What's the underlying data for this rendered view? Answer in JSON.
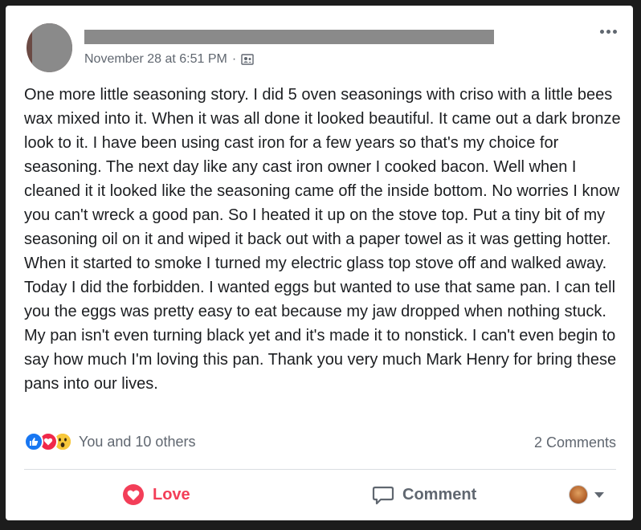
{
  "post": {
    "timestamp": "November 28 at 6:51 PM",
    "separator": "·",
    "audience_icon": "friends-icon",
    "text": "One more little seasoning story. I did 5 oven seasonings with criso with a little bees wax mixed into it. When it was all done it looked beautiful. It came out a dark bronze look to it. I have been using cast iron for a few years so that's my choice for seasoning. The next day like any cast iron owner I cooked bacon. Well when I cleaned it it looked like the seasoning came off the inside bottom. No worries I know you can't wreck a good pan. So I heated it up on the stove top. Put a tiny bit of my seasoning oil on it and wiped it back out with a paper towel as it was getting hotter. When it started to smoke I turned my electric glass top stove off and walked away. Today I did the forbidden. I wanted eggs but wanted to use that same pan. I can tell you the eggs was pretty easy to eat because my jaw dropped when nothing stuck. My pan isn't even turning black yet and it's made it to nonstick. I can't even begin to say how much I'm loving this pan. Thank you very much Mark Henry for bring these pans into our lives."
  },
  "reactions": {
    "summary": "You and 10 others",
    "types": [
      "like",
      "love",
      "wow"
    ],
    "colors": {
      "like": "#1877f2",
      "love": "#f0284a",
      "wow": "#f7b125"
    }
  },
  "comments": {
    "count_label": "2 Comments"
  },
  "actions": {
    "love_label": "Love",
    "love_color": "#f33e58",
    "comment_label": "Comment"
  }
}
